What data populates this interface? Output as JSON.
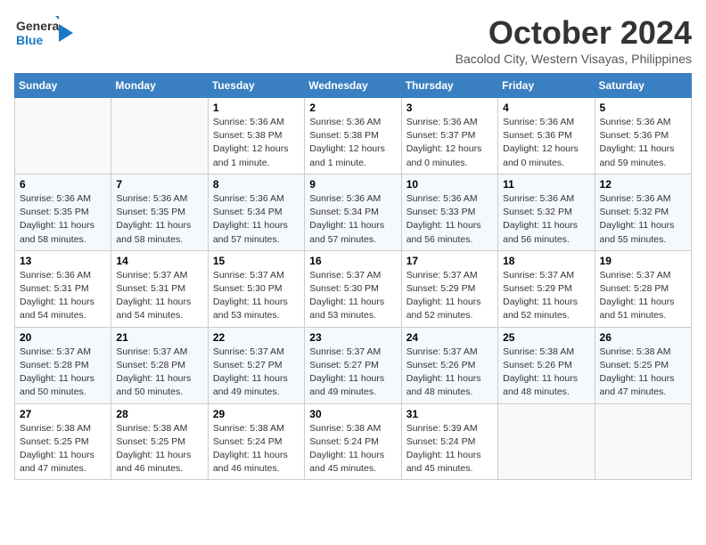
{
  "header": {
    "logo_line1": "General",
    "logo_line2": "Blue",
    "month": "October 2024",
    "location": "Bacolod City, Western Visayas, Philippines"
  },
  "weekdays": [
    "Sunday",
    "Monday",
    "Tuesday",
    "Wednesday",
    "Thursday",
    "Friday",
    "Saturday"
  ],
  "weeks": [
    [
      {
        "day": "",
        "text": ""
      },
      {
        "day": "",
        "text": ""
      },
      {
        "day": "1",
        "text": "Sunrise: 5:36 AM\nSunset: 5:38 PM\nDaylight: 12 hours\nand 1 minute."
      },
      {
        "day": "2",
        "text": "Sunrise: 5:36 AM\nSunset: 5:38 PM\nDaylight: 12 hours\nand 1 minute."
      },
      {
        "day": "3",
        "text": "Sunrise: 5:36 AM\nSunset: 5:37 PM\nDaylight: 12 hours\nand 0 minutes."
      },
      {
        "day": "4",
        "text": "Sunrise: 5:36 AM\nSunset: 5:36 PM\nDaylight: 12 hours\nand 0 minutes."
      },
      {
        "day": "5",
        "text": "Sunrise: 5:36 AM\nSunset: 5:36 PM\nDaylight: 11 hours\nand 59 minutes."
      }
    ],
    [
      {
        "day": "6",
        "text": "Sunrise: 5:36 AM\nSunset: 5:35 PM\nDaylight: 11 hours\nand 58 minutes."
      },
      {
        "day": "7",
        "text": "Sunrise: 5:36 AM\nSunset: 5:35 PM\nDaylight: 11 hours\nand 58 minutes."
      },
      {
        "day": "8",
        "text": "Sunrise: 5:36 AM\nSunset: 5:34 PM\nDaylight: 11 hours\nand 57 minutes."
      },
      {
        "day": "9",
        "text": "Sunrise: 5:36 AM\nSunset: 5:34 PM\nDaylight: 11 hours\nand 57 minutes."
      },
      {
        "day": "10",
        "text": "Sunrise: 5:36 AM\nSunset: 5:33 PM\nDaylight: 11 hours\nand 56 minutes."
      },
      {
        "day": "11",
        "text": "Sunrise: 5:36 AM\nSunset: 5:32 PM\nDaylight: 11 hours\nand 56 minutes."
      },
      {
        "day": "12",
        "text": "Sunrise: 5:36 AM\nSunset: 5:32 PM\nDaylight: 11 hours\nand 55 minutes."
      }
    ],
    [
      {
        "day": "13",
        "text": "Sunrise: 5:36 AM\nSunset: 5:31 PM\nDaylight: 11 hours\nand 54 minutes."
      },
      {
        "day": "14",
        "text": "Sunrise: 5:37 AM\nSunset: 5:31 PM\nDaylight: 11 hours\nand 54 minutes."
      },
      {
        "day": "15",
        "text": "Sunrise: 5:37 AM\nSunset: 5:30 PM\nDaylight: 11 hours\nand 53 minutes."
      },
      {
        "day": "16",
        "text": "Sunrise: 5:37 AM\nSunset: 5:30 PM\nDaylight: 11 hours\nand 53 minutes."
      },
      {
        "day": "17",
        "text": "Sunrise: 5:37 AM\nSunset: 5:29 PM\nDaylight: 11 hours\nand 52 minutes."
      },
      {
        "day": "18",
        "text": "Sunrise: 5:37 AM\nSunset: 5:29 PM\nDaylight: 11 hours\nand 52 minutes."
      },
      {
        "day": "19",
        "text": "Sunrise: 5:37 AM\nSunset: 5:28 PM\nDaylight: 11 hours\nand 51 minutes."
      }
    ],
    [
      {
        "day": "20",
        "text": "Sunrise: 5:37 AM\nSunset: 5:28 PM\nDaylight: 11 hours\nand 50 minutes."
      },
      {
        "day": "21",
        "text": "Sunrise: 5:37 AM\nSunset: 5:28 PM\nDaylight: 11 hours\nand 50 minutes."
      },
      {
        "day": "22",
        "text": "Sunrise: 5:37 AM\nSunset: 5:27 PM\nDaylight: 11 hours\nand 49 minutes."
      },
      {
        "day": "23",
        "text": "Sunrise: 5:37 AM\nSunset: 5:27 PM\nDaylight: 11 hours\nand 49 minutes."
      },
      {
        "day": "24",
        "text": "Sunrise: 5:37 AM\nSunset: 5:26 PM\nDaylight: 11 hours\nand 48 minutes."
      },
      {
        "day": "25",
        "text": "Sunrise: 5:38 AM\nSunset: 5:26 PM\nDaylight: 11 hours\nand 48 minutes."
      },
      {
        "day": "26",
        "text": "Sunrise: 5:38 AM\nSunset: 5:25 PM\nDaylight: 11 hours\nand 47 minutes."
      }
    ],
    [
      {
        "day": "27",
        "text": "Sunrise: 5:38 AM\nSunset: 5:25 PM\nDaylight: 11 hours\nand 47 minutes."
      },
      {
        "day": "28",
        "text": "Sunrise: 5:38 AM\nSunset: 5:25 PM\nDaylight: 11 hours\nand 46 minutes."
      },
      {
        "day": "29",
        "text": "Sunrise: 5:38 AM\nSunset: 5:24 PM\nDaylight: 11 hours\nand 46 minutes."
      },
      {
        "day": "30",
        "text": "Sunrise: 5:38 AM\nSunset: 5:24 PM\nDaylight: 11 hours\nand 45 minutes."
      },
      {
        "day": "31",
        "text": "Sunrise: 5:39 AM\nSunset: 5:24 PM\nDaylight: 11 hours\nand 45 minutes."
      },
      {
        "day": "",
        "text": ""
      },
      {
        "day": "",
        "text": ""
      }
    ]
  ]
}
